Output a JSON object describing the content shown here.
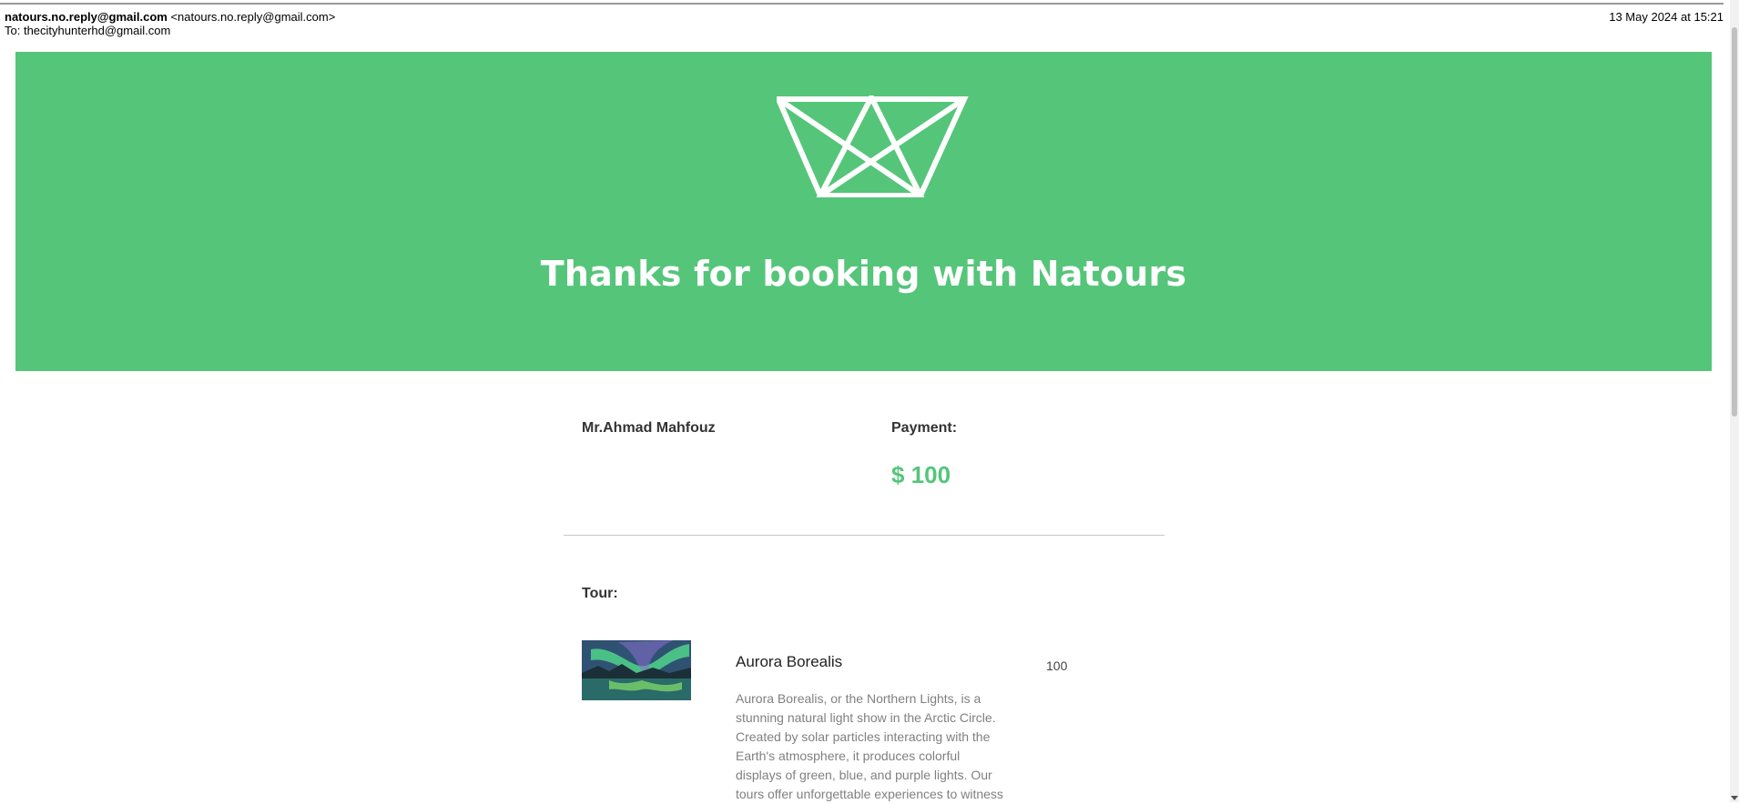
{
  "email": {
    "from_name": "natours.no.reply@gmail.com",
    "from_address": "<natours.no.reply@gmail.com>",
    "to_label": "To:",
    "to_address": "thecityhunterhd@gmail.com",
    "date": "13 May 2024 at 15:21"
  },
  "colors": {
    "brand_green": "#55c57a",
    "text_dark": "#333333",
    "text_muted": "#808080"
  },
  "banner": {
    "logo_icon": "natours-crown-logo-icon",
    "title": "Thanks for booking with Natours"
  },
  "booking": {
    "customer_name": "Mr.Ahmad Mahfouz",
    "payment_label": "Payment:",
    "payment_amount": "$ 100"
  },
  "tour": {
    "section_label": "Tour:",
    "image_icon": "aurora-photo",
    "name": "Aurora Borealis",
    "price": "100",
    "description": "Aurora Borealis, or the Northern Lights, is a stunning natural light show in the Arctic Circle. Created by solar particles interacting with the Earth's atmosphere, it produces colorful displays of green, blue, and purple lights. Our tours offer unforgettable experiences to witness"
  }
}
